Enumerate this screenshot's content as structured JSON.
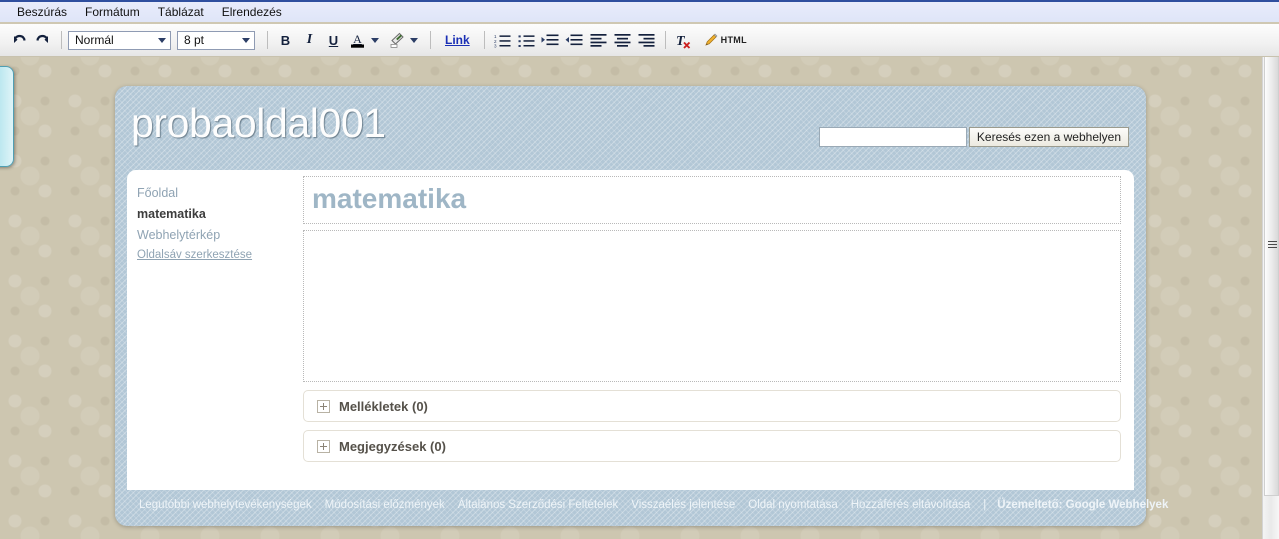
{
  "menubar": {
    "items": [
      {
        "label": "Beszúrás",
        "name": "menu-insert"
      },
      {
        "label": "Formátum",
        "name": "menu-format"
      },
      {
        "label": "Táblázat",
        "name": "menu-table"
      },
      {
        "label": "Elrendezés",
        "name": "menu-layout"
      }
    ]
  },
  "toolbar": {
    "undo_icon": "undo-arrow-icon",
    "redo_icon": "redo-arrow-icon",
    "style_select": {
      "value": "Normál",
      "options": [
        "Normál"
      ]
    },
    "size_select": {
      "value": "8 pt",
      "options": [
        "8 pt"
      ]
    },
    "bold_label": "B",
    "italic_label": "I",
    "underline_label": "U",
    "text_color_label": "A",
    "highlight_icon": "highlighter-icon",
    "link_label": "Link",
    "numbered_list_icon": "numbered-list-icon",
    "bulleted_list_icon": "bulleted-list-icon",
    "indent_icon": "indent-increase-icon",
    "outdent_icon": "indent-decrease-icon",
    "align_left_icon": "align-left-icon",
    "align_center_icon": "align-center-icon",
    "align_right_icon": "align-right-icon",
    "clear_format_icon": "remove-formatting-icon",
    "html_label": "HTML",
    "html_icon": "pencil-icon"
  },
  "site": {
    "title": "probaoldal001",
    "search": {
      "value": "",
      "placeholder": "",
      "button_label": "Keresés ezen a webhelyen"
    },
    "sidebar": {
      "items": [
        {
          "label": "Főoldal",
          "name": "sidebar-item-home",
          "current": false
        },
        {
          "label": "matematika",
          "name": "sidebar-item-matematika",
          "current": true
        },
        {
          "label": "Webhelytérkép",
          "name": "sidebar-item-sitemap",
          "current": false
        }
      ],
      "edit_label": "Oldalsáv szerkesztése"
    },
    "page": {
      "title": "matematika",
      "body_text": ""
    },
    "sections": [
      {
        "label": "Mellékletek (0)",
        "name": "attachments-section",
        "icon": "plus-box-icon"
      },
      {
        "label": "Megjegyzések (0)",
        "name": "comments-section",
        "icon": "plus-box-icon"
      }
    ],
    "footer": {
      "links": [
        "Legutóbbi webhelytevékenységek",
        "Módosítási előzmények",
        "Általános Szerződési Feltételek",
        "Visszaélés jelentése",
        "Oldal nyomtatása",
        "Hozzáférés eltávolítása"
      ],
      "separator": "|",
      "powered_by": "Üzemeltető: Google Webhelyek"
    }
  },
  "colors": {
    "menubar_bg": "#e3e8f8",
    "menubar_top_border": "#2f4f9f",
    "site_frame": "#b2c7d6",
    "site_title": "#fdfdfd",
    "page_title": "#9fb6c6",
    "sidebar_link": "#8fa3b3",
    "desktop_bg": "#cdc6b0",
    "link_blue": "#1a2fb5",
    "footer_text": "#eef4f8"
  },
  "scrollbar": {
    "orientation": "vertical",
    "position_label": ""
  }
}
